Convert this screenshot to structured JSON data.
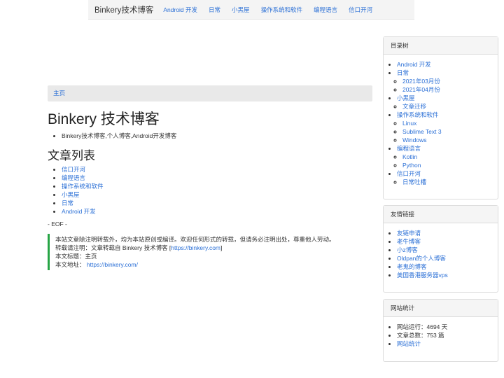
{
  "navbar": {
    "brand": "Binkery技术博客",
    "links": [
      "Android 开发",
      "日常",
      "小黑屋",
      "操作系统和软件",
      "编程语言",
      "信口开河"
    ]
  },
  "breadcrumb": {
    "home": "主页"
  },
  "page": {
    "title": "Binkery 技术博客",
    "subtitle": "Binkery技术博客,个人博客,Android开发博客",
    "section_title": "文章列表",
    "articles": [
      "信口开河",
      "编程语言",
      "操作系统和软件",
      "小黑屋",
      "日常",
      "Android 开发"
    ],
    "eof": "- EOF -",
    "quote": {
      "line1": "本站文章除注明转载外，均为本站原创或编译。欢迎任何形式的转载，但请务必注明出处，尊重他人劳动。",
      "line2_prefix": "转载请注明：文章转载自 Binkery 技术博客 [",
      "line2_link": "https://binkery.com",
      "line2_suffix": "]",
      "line3": "本文标题：主页",
      "line4_prefix": "本文地址：",
      "line4_link": "https://binkery.com/"
    }
  },
  "sidebar": {
    "toc": {
      "heading": "目录树",
      "items": [
        {
          "label": "Android 开发",
          "children": []
        },
        {
          "label": "日常",
          "children": [
            "2021年03月份",
            "2021年04月份"
          ]
        },
        {
          "label": "小黑屋",
          "children": [
            "文章迁移"
          ]
        },
        {
          "label": "操作系统和软件",
          "children": [
            "Linux",
            "Sublime Text 3",
            "Windows"
          ]
        },
        {
          "label": "编程语言",
          "children": [
            "Kotlin",
            "Python"
          ]
        },
        {
          "label": "信口开河",
          "children": [
            "日常吐槽"
          ]
        }
      ]
    },
    "friends": {
      "heading": "友情链接",
      "items": [
        "友链申请",
        "老牛博客",
        "小z博客",
        "Oldpan的个人博客",
        "老鬼的博客",
        "美国香港服务器vps"
      ]
    },
    "stats": {
      "heading": "网站统计",
      "running": "网站运行：4694 天",
      "articles": "文章总数：753 篇",
      "link": "网站统计"
    }
  }
}
